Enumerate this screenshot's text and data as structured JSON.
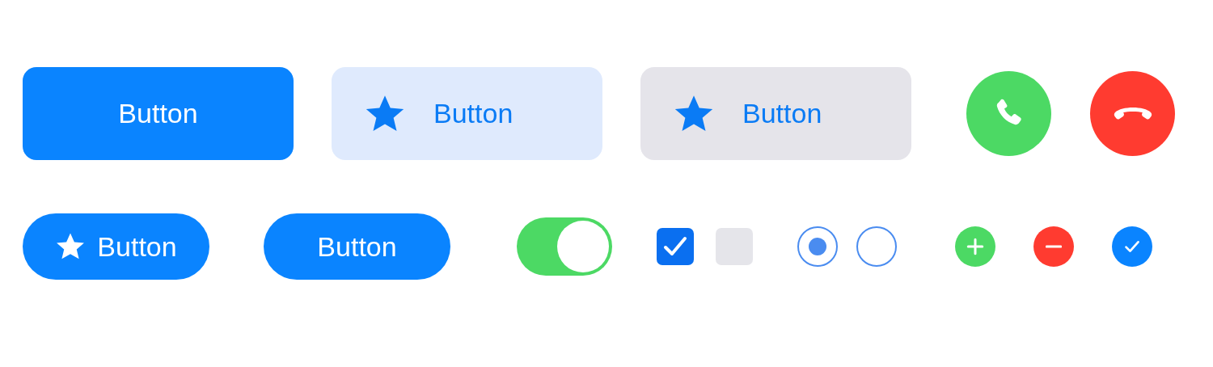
{
  "large_buttons": [
    {
      "kind": "filled",
      "icon": false,
      "label": "Button"
    },
    {
      "kind": "tinted",
      "icon": true,
      "label": "Button"
    },
    {
      "kind": "gray",
      "icon": true,
      "label": "Button"
    }
  ],
  "call_buttons": [
    {
      "kind": "accept"
    },
    {
      "kind": "decline"
    }
  ],
  "pill_buttons": [
    {
      "icon": true,
      "label": "Button"
    },
    {
      "icon": false,
      "label": "Button"
    }
  ],
  "toggle": {
    "on": true
  },
  "checkboxes": [
    {
      "checked": true
    },
    {
      "checked": false
    }
  ],
  "radios": [
    {
      "selected": true
    },
    {
      "selected": false
    }
  ],
  "circle_actions": [
    {
      "kind": "add"
    },
    {
      "kind": "remove"
    },
    {
      "kind": "done"
    }
  ]
}
